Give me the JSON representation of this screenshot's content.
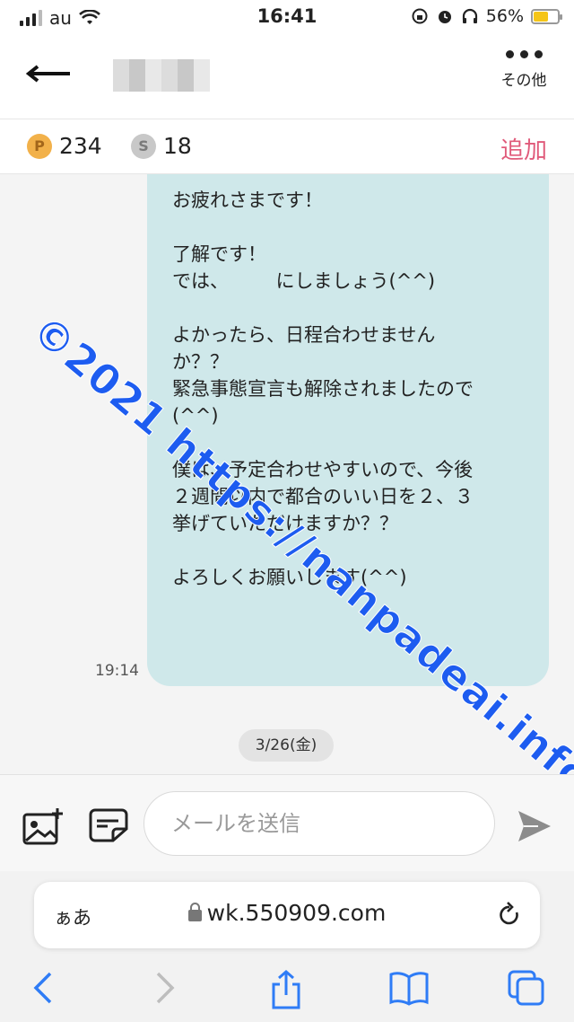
{
  "status_bar": {
    "carrier": "au",
    "time": "16:41",
    "battery": "56%"
  },
  "header": {
    "more_label": "その他"
  },
  "points": {
    "p_badge": "P",
    "p_value": "234",
    "s_badge": "S",
    "s_value": "18",
    "add_label": "追加"
  },
  "message": {
    "text": "お疲れさまです！\n\n了解です！\nでは、　　　にしましょう(^^)\n\nよかったら、日程合わせません\nか？？\n緊急事態宣言も解除されましたので\n(^^)\n\n僕は、予定合わせやすいので、今後\n２週間以内で都合のいい日を２、３\n挙げていただけますか？？\n\nよろしくお願いします(^^)",
    "time": "19:14"
  },
  "date_separator": "3/26(金)",
  "watermark": "©2021 https://nanpadeai.info/",
  "compose": {
    "placeholder": "メールを送信"
  },
  "browser": {
    "aa_label": "ぁあ",
    "url": "wk.550909.com"
  },
  "colors": {
    "bubble": "#cfe8ea",
    "accent_add": "#e05a7a",
    "watermark": "#1d5cf0"
  }
}
